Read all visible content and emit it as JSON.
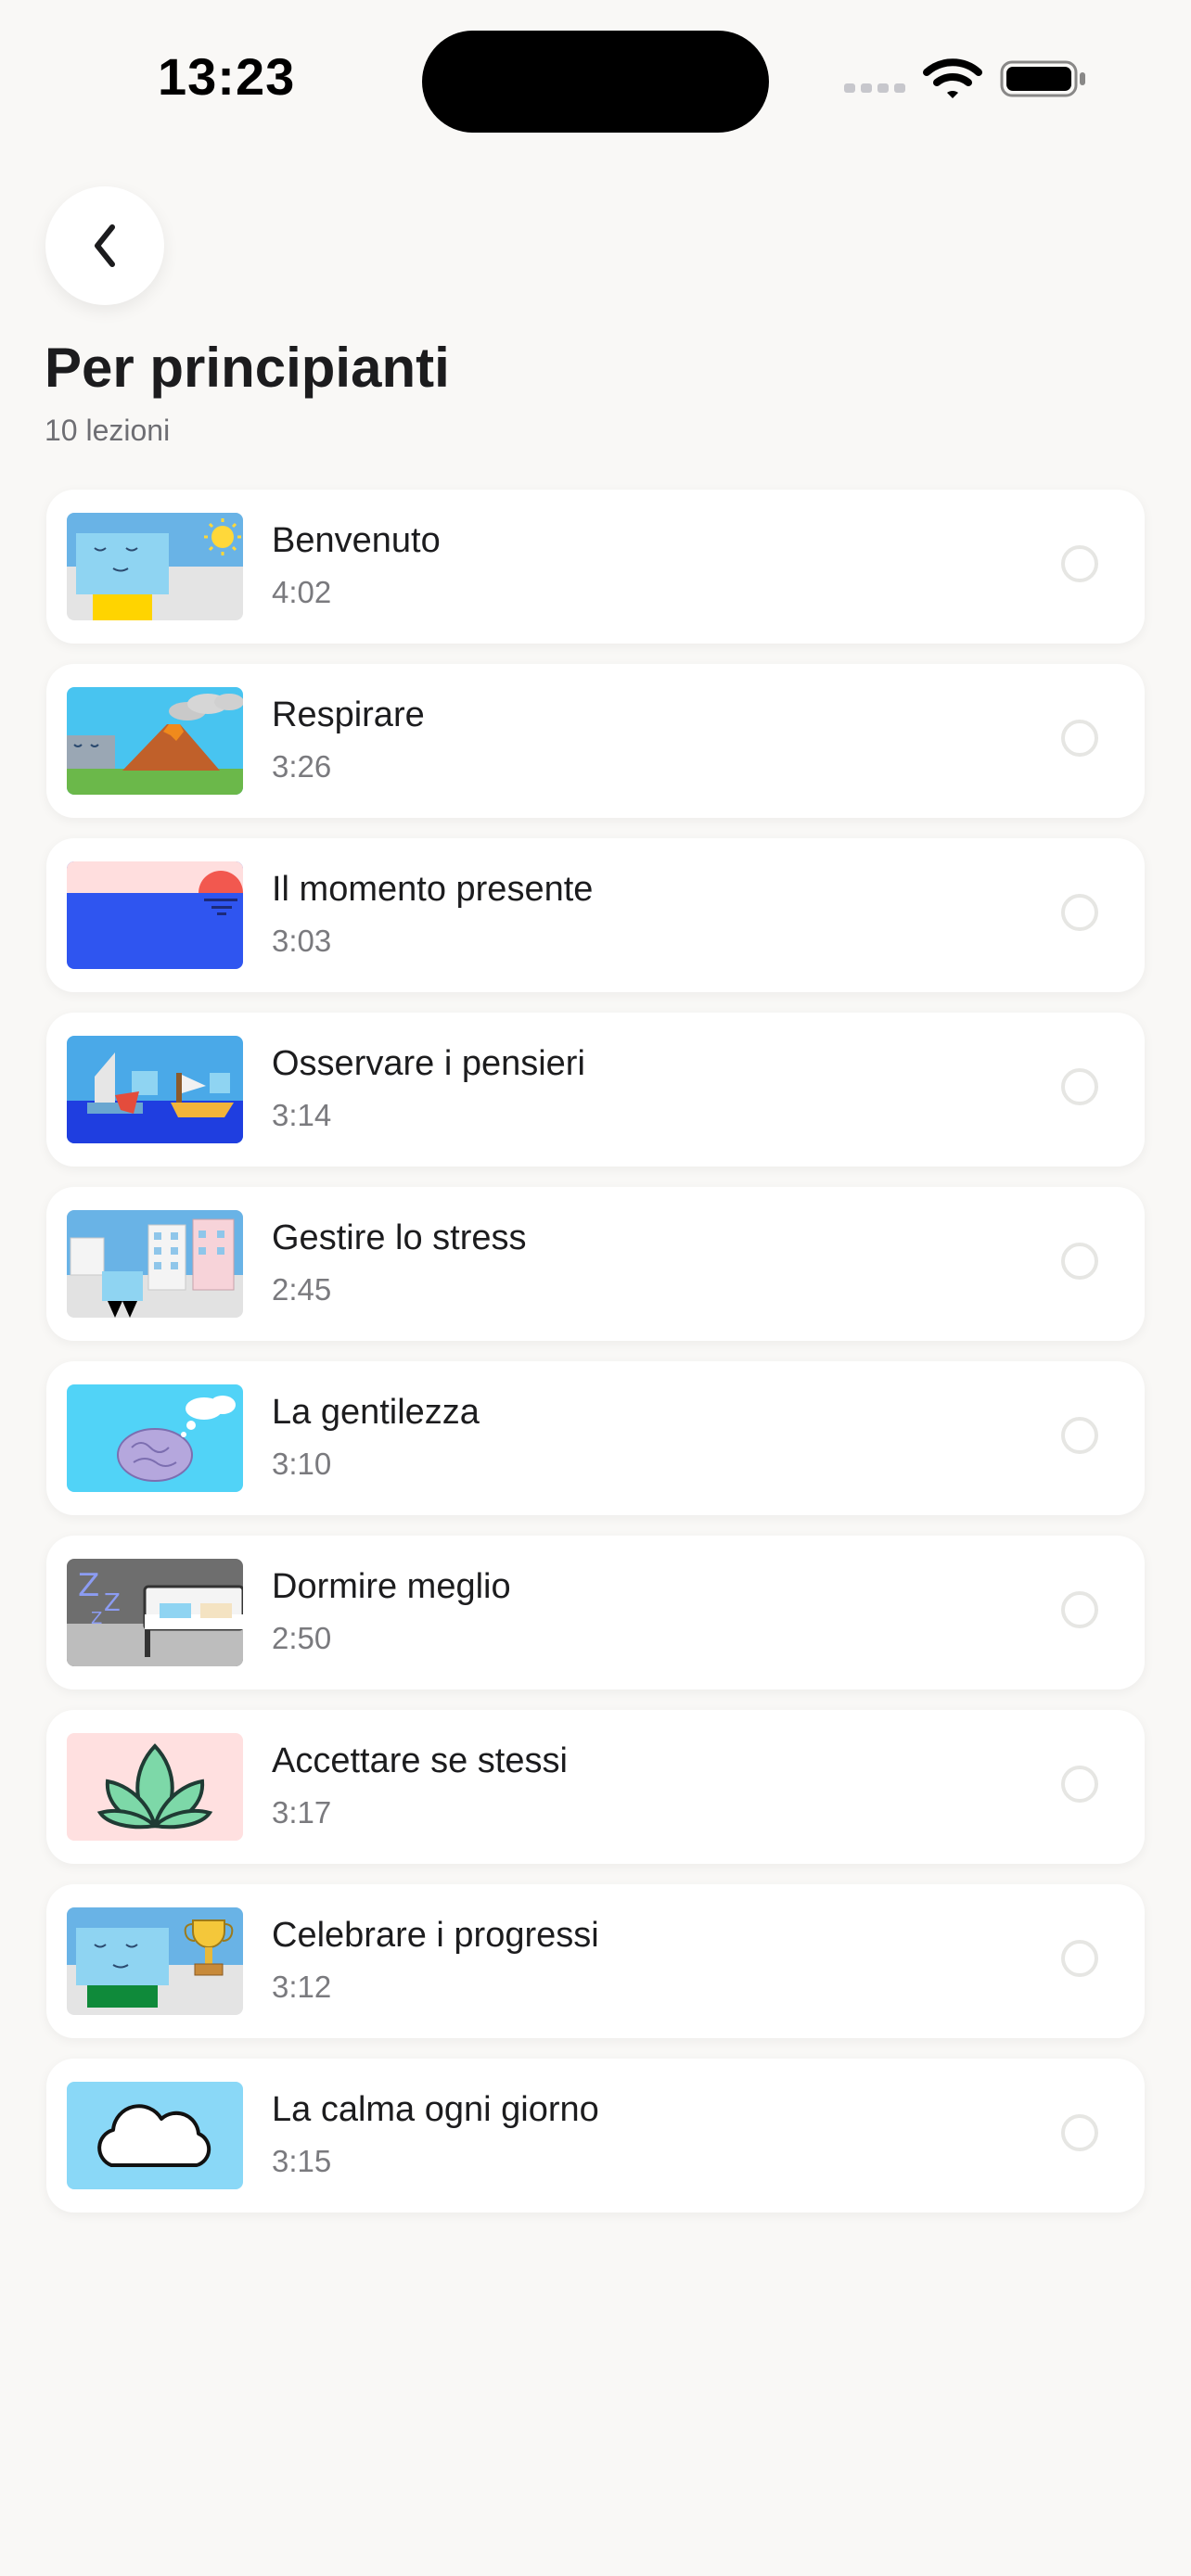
{
  "status_bar": {
    "time": "13:23"
  },
  "header": {
    "title": "Per principianti",
    "subtitle": "10 lezioni"
  },
  "icons": {
    "back": "chevron-left-icon",
    "wifi": "wifi-icon",
    "battery": "battery-icon",
    "lesson_status": "empty-circle-icon"
  },
  "lessons": [
    {
      "title": "Benvenuto",
      "duration": "4:02",
      "thumbnail": "face-sun-thumbnail"
    },
    {
      "title": "Respirare",
      "duration": "3:26",
      "thumbnail": "volcano-thumbnail"
    },
    {
      "title": "Il momento presente",
      "duration": "3:03",
      "thumbnail": "sunset-sea-thumbnail"
    },
    {
      "title": "Osservare i pensieri",
      "duration": "3:14",
      "thumbnail": "boats-thumbnail"
    },
    {
      "title": "Gestire lo stress",
      "duration": "2:45",
      "thumbnail": "city-thumbnail"
    },
    {
      "title": "La gentilezza",
      "duration": "3:10",
      "thumbnail": "brain-thumbnail"
    },
    {
      "title": "Dormire meglio",
      "duration": "2:50",
      "thumbnail": "sleep-thumbnail"
    },
    {
      "title": "Accettare se stessi",
      "duration": "3:17",
      "thumbnail": "lotus-thumbnail"
    },
    {
      "title": "Celebrare i progressi",
      "duration": "3:12",
      "thumbnail": "trophy-thumbnail"
    },
    {
      "title": "La calma ogni giorno",
      "duration": "3:15",
      "thumbnail": "cloud-thumbnail"
    }
  ],
  "colors": {
    "background": "#f9f8f6",
    "card": "#ffffff",
    "title": "#1c1c1e",
    "secondary": "#6e6e73"
  }
}
